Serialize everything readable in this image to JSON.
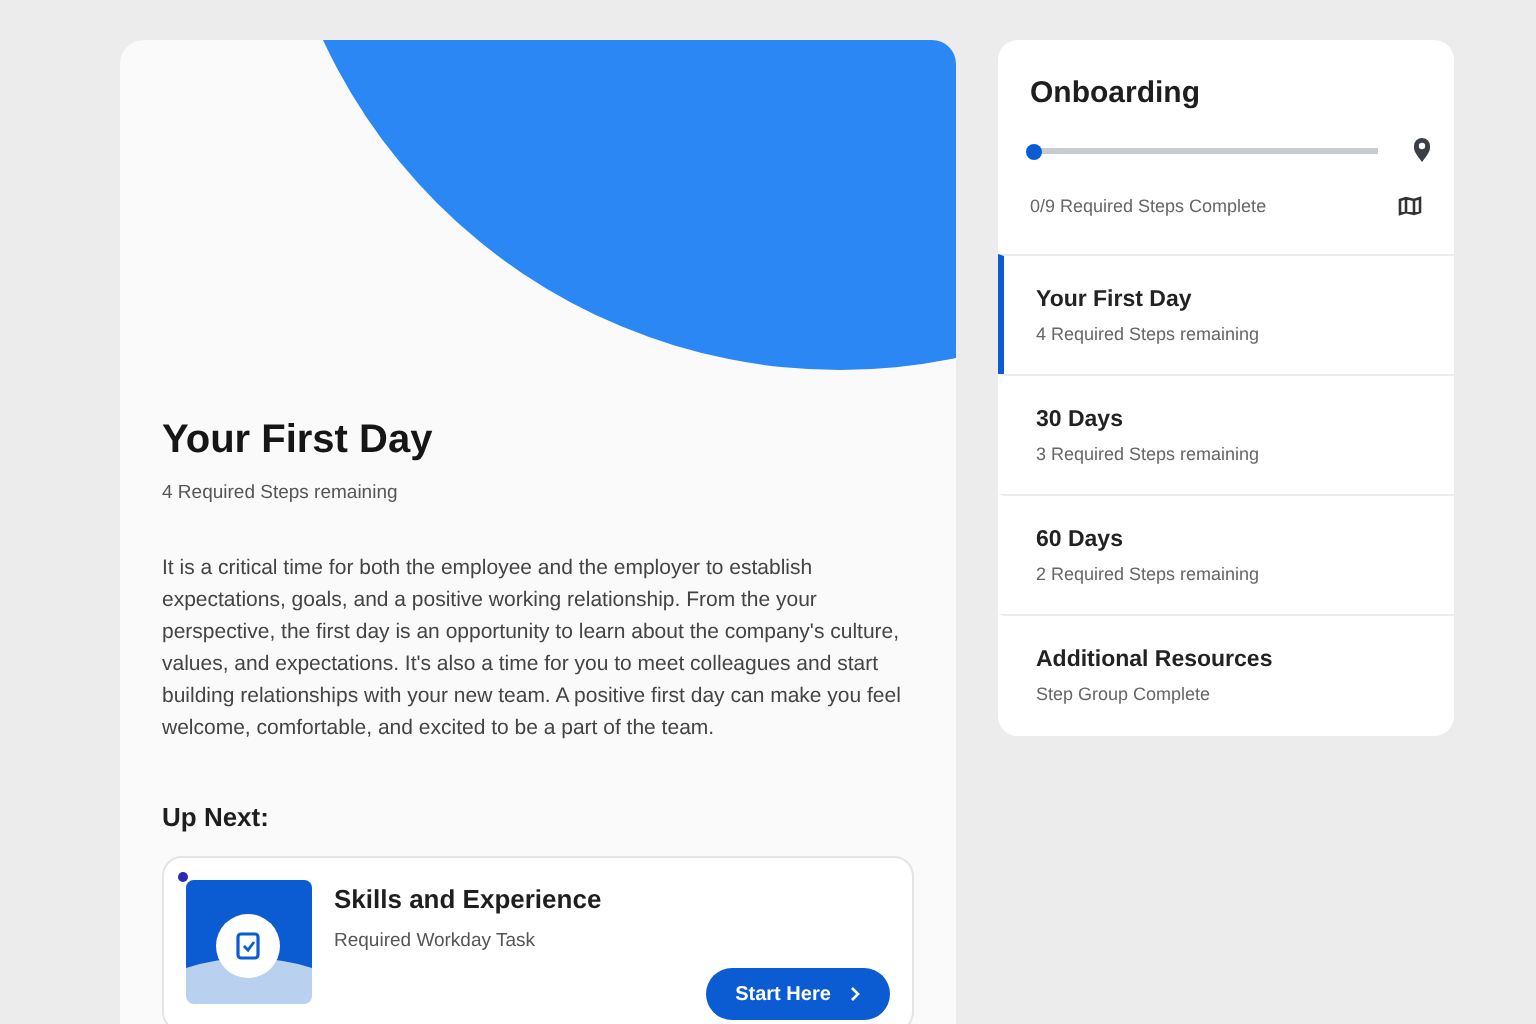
{
  "main": {
    "title": "Your First Day",
    "subtitle": "4 Required Steps remaining",
    "description": "It is a critical time for both the employee and the employer to establish expectations, goals, and a positive working relationship. From the your perspective, the first day is an opportunity to learn about the company's culture, values, and expectations. It's also a time for you to meet colleagues and start building relationships with your new team. A positive first day can make you feel welcome, comfortable, and excited to be a part of the team.",
    "up_next_heading": "Up Next:",
    "task": {
      "title": "Skills and Experience",
      "subtitle": "Required Workday Task",
      "button": "Start Here",
      "unread": true
    }
  },
  "onboarding": {
    "title": "Onboarding",
    "progress": {
      "level": 0
    },
    "progress_text": "0/9 Required Steps Complete",
    "groups": [
      {
        "title": "Your First Day",
        "status": "4 Required Steps remaining",
        "selected": true
      },
      {
        "title": "30 Days",
        "status": "3 Required Steps remaining",
        "selected": false
      },
      {
        "title": "60 Days",
        "status": "2 Required Steps remaining",
        "selected": false
      },
      {
        "title": "Additional Resources",
        "status": "Step Group Complete",
        "selected": false
      }
    ]
  }
}
